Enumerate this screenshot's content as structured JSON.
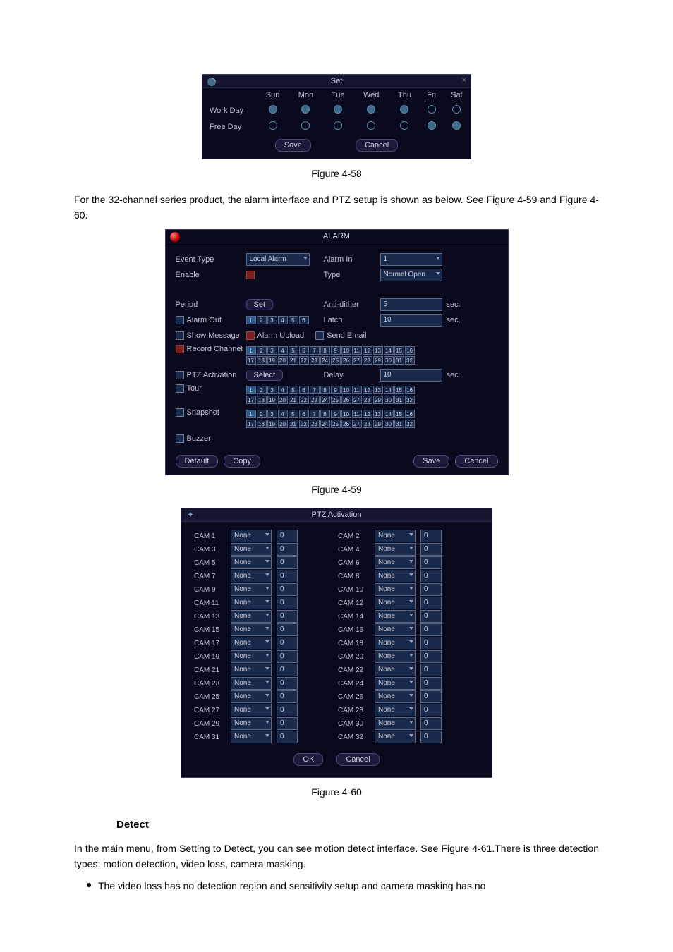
{
  "setDialog": {
    "title": "Set",
    "days": [
      "Sun",
      "Mon",
      "Tue",
      "Wed",
      "Thu",
      "Fri",
      "Sat"
    ],
    "rows": [
      {
        "label": "Work Day",
        "states": [
          "on",
          "on",
          "on",
          "on",
          "on",
          "off",
          "off"
        ]
      },
      {
        "label": "Free Day",
        "states": [
          "off",
          "off",
          "off",
          "off",
          "off",
          "on",
          "on"
        ]
      }
    ],
    "save": "Save",
    "cancel": "Cancel"
  },
  "fig1": "Figure 4-58",
  "para1": "For the 32-channel series product, the alarm interface and PTZ setup is shown as below. See Figure 4-59 and Figure 4-60.",
  "alarmDialog": {
    "title": "ALARM",
    "eventType": "Event Type",
    "eventTypeVal": "Local Alarm",
    "alarmIn": "Alarm In",
    "alarmInVal": "1",
    "enable": "Enable",
    "type": "Type",
    "typeVal": "Normal Open",
    "period": "Period",
    "set": "Set",
    "antiDither": "Anti-dither",
    "antiDitherVal": "5",
    "sec": "sec.",
    "alarmOut": "Alarm Out",
    "latch": "Latch",
    "latchVal": "10",
    "showMessage": "Show Message",
    "alarmUpload": "Alarm Upload",
    "sendEmail": "Send Email",
    "recordChannel": "Record Channel",
    "ptzActivation": "PTZ Activation",
    "select": "Select",
    "delay": "Delay",
    "delayVal": "10",
    "tour": "Tour",
    "snapshot": "Snapshot",
    "buzzer": "Buzzer",
    "default": "Default",
    "copy": "Copy",
    "save": "Save",
    "cancel": "Cancel",
    "ch1to16": [
      "1",
      "2",
      "3",
      "4",
      "5",
      "6",
      "7",
      "8",
      "9",
      "10",
      "11",
      "12",
      "13",
      "14",
      "15",
      "16"
    ],
    "ch17to32": [
      "17",
      "18",
      "19",
      "20",
      "21",
      "22",
      "23",
      "24",
      "25",
      "26",
      "27",
      "28",
      "29",
      "30",
      "31",
      "32"
    ],
    "alarmOutBoxes": [
      "1",
      "2",
      "3",
      "4",
      "5",
      "6"
    ]
  },
  "fig2": "Figure 4-59",
  "ptzDialog": {
    "title": "PTZ Activation",
    "none": "None",
    "zero": "0",
    "ok": "OK",
    "cancel": "Cancel",
    "camsLeft": [
      "CAM 1",
      "CAM 3",
      "CAM 5",
      "CAM 7",
      "CAM 9",
      "CAM 11",
      "CAM 13",
      "CAM 15",
      "CAM 17",
      "CAM 19",
      "CAM 21",
      "CAM 23",
      "CAM 25",
      "CAM 27",
      "CAM 29",
      "CAM 31"
    ],
    "camsRight": [
      "CAM 2",
      "CAM 4",
      "CAM 6",
      "CAM 8",
      "CAM 10",
      "CAM 12",
      "CAM 14",
      "CAM 16",
      "CAM 18",
      "CAM 20",
      "CAM 22",
      "CAM 24",
      "CAM 26",
      "CAM 28",
      "CAM 30",
      "CAM 32"
    ]
  },
  "fig3": "Figure 4-60",
  "detect": "Detect",
  "para2": "In the main menu, from Setting to Detect, you can see motion detect interface. See Figure 4-61.There is three detection types: motion detection, video loss, camera masking.",
  "bullet1": "The video loss has no detection region and sensitivity setup and camera masking has no"
}
